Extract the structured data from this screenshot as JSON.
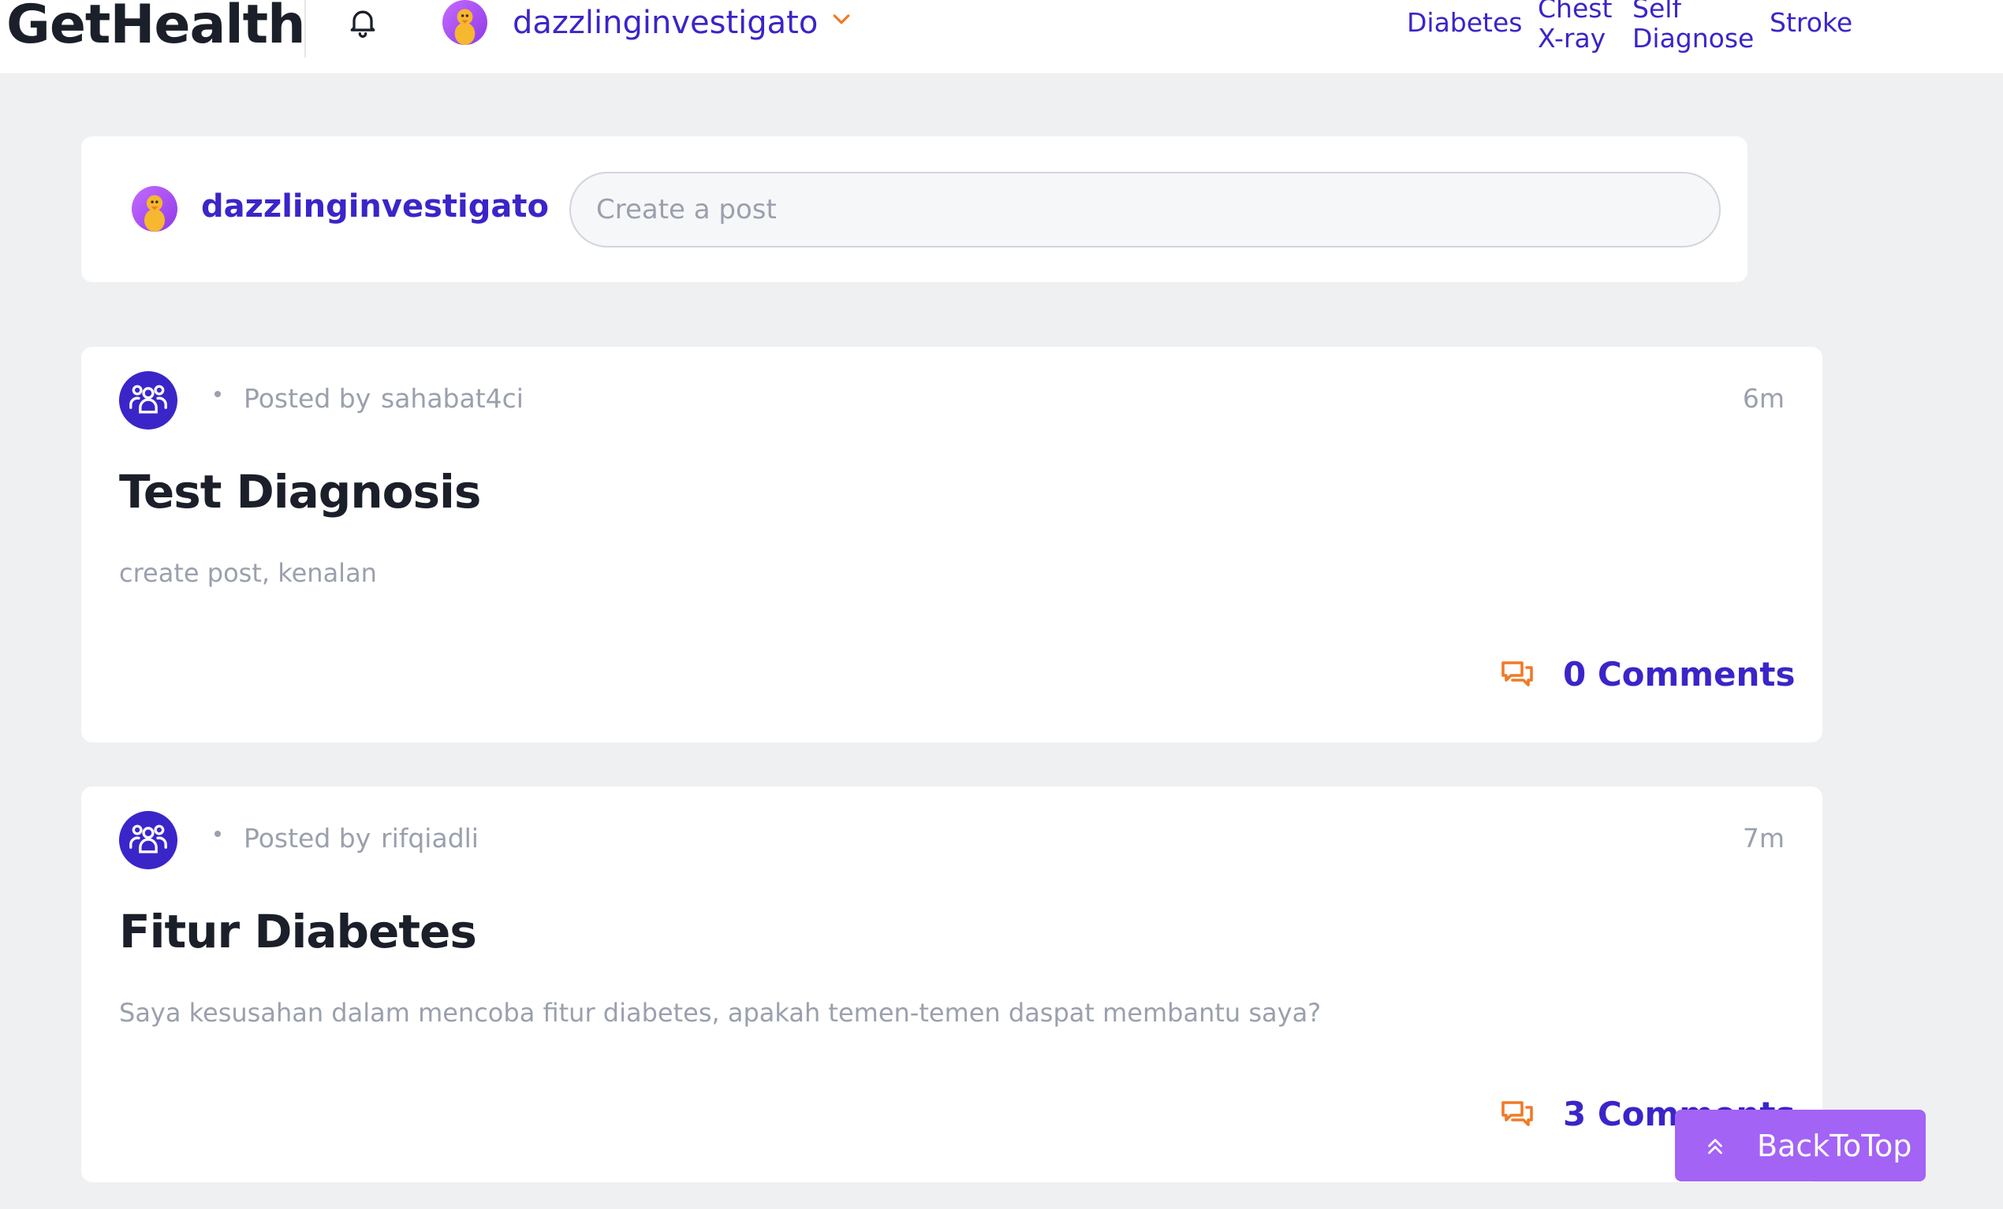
{
  "header": {
    "brand": "GetHealth",
    "username": "dazzlinginvestigato",
    "nav": [
      {
        "label": "Diabetes"
      },
      {
        "label": "Chest X-ray"
      },
      {
        "label": "Self Diagnose"
      },
      {
        "label": "Stroke"
      }
    ]
  },
  "create_post": {
    "username": "dazzlinginvestigato",
    "placeholder": "Create a post"
  },
  "posts": [
    {
      "posted_by_label": "Posted by",
      "author": "sahabat4ci",
      "time": "6m",
      "title": "Test Diagnosis",
      "body": "create post, kenalan",
      "comments": "0 Comments"
    },
    {
      "posted_by_label": "Posted by",
      "author": "rifqiadli",
      "time": "7m",
      "title": "Fitur Diabetes",
      "body": "Saya kesusahan dalam mencoba fitur diabetes, apakah temen-temen daspat membantu saya?",
      "comments": "3 Comments"
    }
  ],
  "back_to_top": "BackToTop",
  "colors": {
    "accent": "#3a25c9",
    "orange": "#f07a28",
    "back_to_top_bg": "#a363f5",
    "page_bg": "#eff0f2"
  }
}
